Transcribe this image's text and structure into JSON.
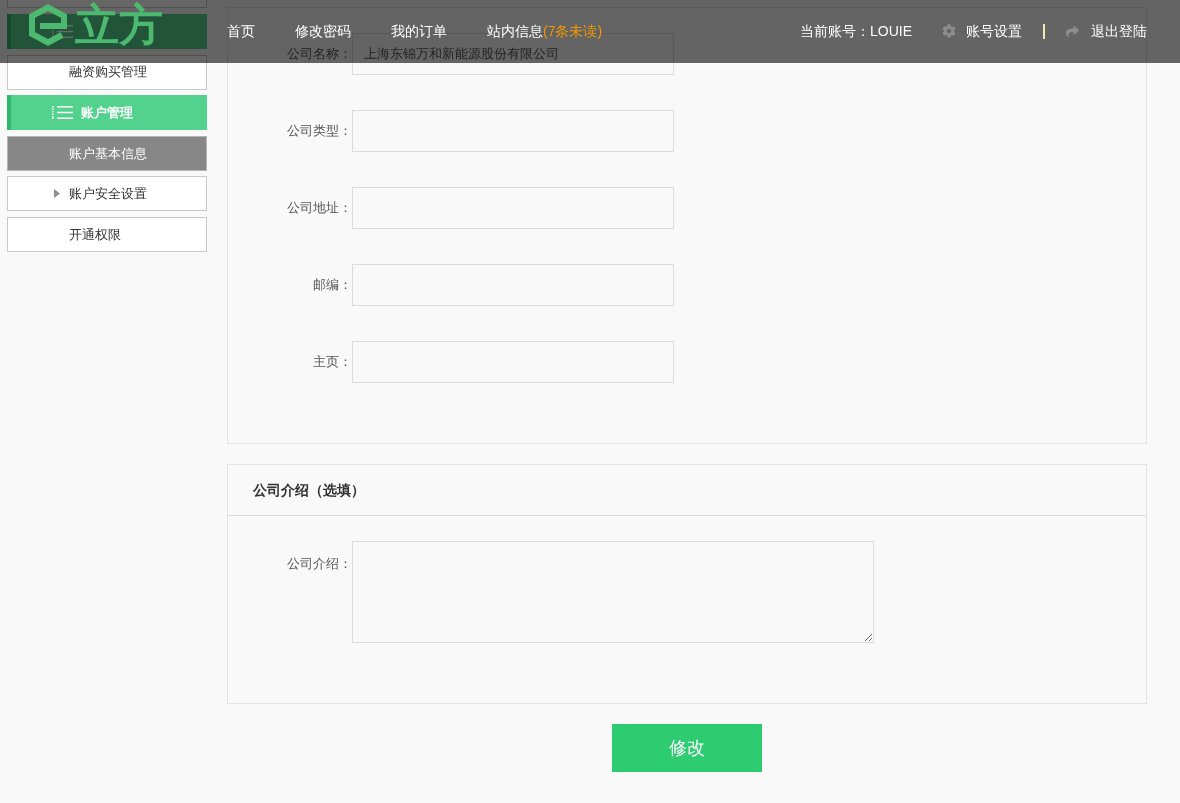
{
  "header": {
    "logo": {
      "text": "立方"
    },
    "nav": [
      {
        "label": "首页"
      },
      {
        "label": "修改密码"
      },
      {
        "label": "我的订单"
      },
      {
        "label": "站内信息",
        "unread": "(7条未读)"
      }
    ],
    "account": {
      "label": "当前账号：LOUIE"
    },
    "actions": [
      {
        "kind": "settings",
        "label": "账号设置"
      },
      {
        "kind": "logout",
        "label": "退出登陆"
      }
    ]
  },
  "sidebar": {
    "groups": [
      {
        "children": [
          {
            "kind": "link",
            "label": "融资购买管理",
            "selected": false
          }
        ]
      },
      {
        "label": "账户管理",
        "children": [
          {
            "kind": "link",
            "label": "账户基本信息",
            "selected": true
          },
          {
            "kind": "submenu",
            "label": "账户安全设置",
            "selected": false
          },
          {
            "kind": "link",
            "label": "开通权限",
            "selected": false
          }
        ]
      }
    ]
  },
  "company_form": {
    "fields": [
      {
        "label": "公司名称：",
        "value": "上海东锦万和新能源股份有限公司"
      },
      {
        "label": "公司类型："
      },
      {
        "label": "公司地址："
      },
      {
        "label": "邮编："
      },
      {
        "label": "主页："
      }
    ]
  },
  "intro_panel": {
    "title": "公司介绍（选填）",
    "field": {
      "label": "公司介绍："
    }
  },
  "submit_button": {
    "label": "修改"
  }
}
